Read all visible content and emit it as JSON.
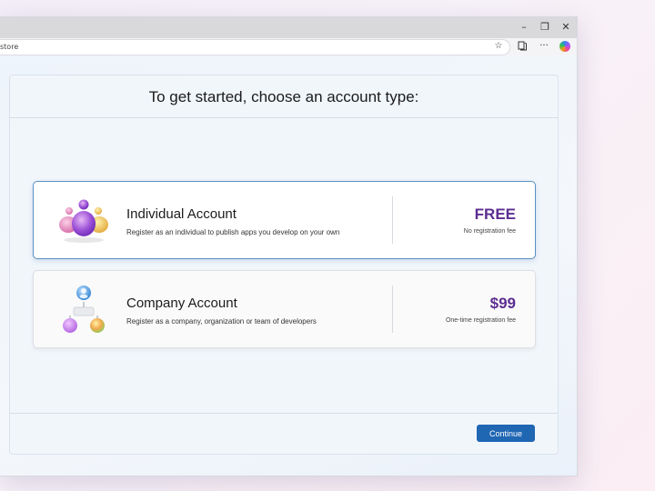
{
  "browser": {
    "address_text": "store",
    "controls": {
      "minimize": "–",
      "restore": "❐",
      "close": "✕"
    },
    "toolbar_icons": [
      "favorites-star-icon",
      "collections-icon",
      "more-icon",
      "copilot-icon"
    ]
  },
  "dialog": {
    "title": "To get started, choose an account type:",
    "options": [
      {
        "title": "Individual Account",
        "description": "Register as an individual to publish apps you develop on your own",
        "price": "FREE",
        "price_note": "No registration fee",
        "selected": true,
        "icon": "individual-people-icon"
      },
      {
        "title": "Company Account",
        "description": "Register as a company, organization or team of developers",
        "price": "$99",
        "price_note": "One-time registration fee",
        "selected": false,
        "icon": "company-org-icon"
      }
    ],
    "continue_label": "Continue"
  },
  "colors": {
    "price": "#5c2d91",
    "button": "#1f66b3",
    "selected_border": "#5a8fc2"
  }
}
